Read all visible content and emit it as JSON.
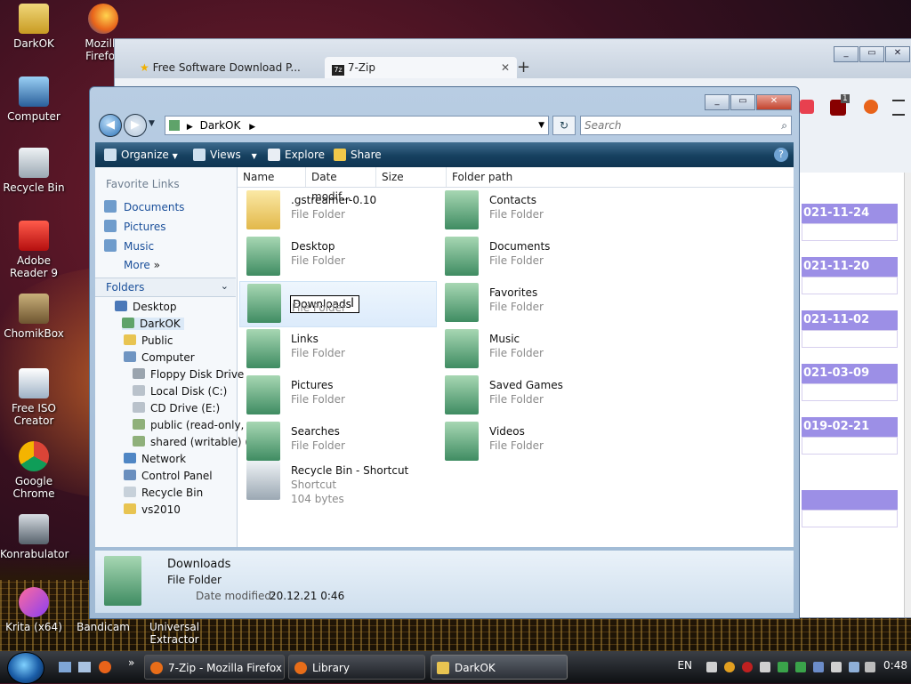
{
  "desktop": {
    "icons": [
      {
        "label": "DarkOK"
      },
      {
        "label": "Computer"
      },
      {
        "label": "Recycle Bin"
      },
      {
        "label": "Adobe Reader 9"
      },
      {
        "label": "ChomikBox"
      },
      {
        "label": "Free ISO Creator"
      },
      {
        "label": "Google Chrome"
      },
      {
        "label": "Konrabulator"
      },
      {
        "label": "Krita (x64)"
      },
      {
        "label": "Bandicam"
      },
      {
        "label": "Universal Extractor"
      },
      {
        "label": "Mozilla Firefox"
      }
    ]
  },
  "firefox": {
    "tabs": [
      {
        "label": "Free Software Download P..."
      },
      {
        "label": "7-Zip"
      }
    ],
    "new_tab": "+",
    "dates": [
      "021-11-24",
      "021-11-20",
      "021-11-02",
      "021-03-09",
      "019-02-21"
    ],
    "ublock_badge": "1"
  },
  "explorer": {
    "address": {
      "root": "DarkOK"
    },
    "search_placeholder": "Search",
    "toolbar": {
      "organize": "Organize",
      "views": "Views",
      "explore": "Explore",
      "share": "Share"
    },
    "favorite_links_header": "Favorite Links",
    "favorites": [
      {
        "label": "Documents"
      },
      {
        "label": "Pictures"
      },
      {
        "label": "Music"
      },
      {
        "label": "More"
      }
    ],
    "folders_header": "Folders",
    "tree": [
      {
        "label": "Desktop"
      },
      {
        "label": "DarkOK"
      },
      {
        "label": "Public"
      },
      {
        "label": "Computer"
      },
      {
        "label": "Floppy Disk Drive"
      },
      {
        "label": "Local Disk (C:)"
      },
      {
        "label": "CD Drive (E:)"
      },
      {
        "label": "public (read-only,"
      },
      {
        "label": "shared (writable) ("
      },
      {
        "label": "Network"
      },
      {
        "label": "Control Panel"
      },
      {
        "label": "Recycle Bin"
      },
      {
        "label": "vs2010"
      }
    ],
    "columns": [
      "Name",
      "Date modif...",
      "Size",
      "Folder path"
    ],
    "items_left": [
      {
        "name": ".gstreamer-0.10",
        "type": "File Folder"
      },
      {
        "name": "Desktop",
        "type": "File Folder"
      },
      {
        "name": "Downloads",
        "type": "File Folder"
      },
      {
        "name": "Links",
        "type": "File Folder"
      },
      {
        "name": "Pictures",
        "type": "File Folder"
      },
      {
        "name": "Searches",
        "type": "File Folder"
      },
      {
        "name": "Recycle Bin - Shortcut",
        "type": "Shortcut",
        "size": "104 bytes"
      }
    ],
    "items_right": [
      {
        "name": "Contacts",
        "type": "File Folder"
      },
      {
        "name": "Documents",
        "type": "File Folder"
      },
      {
        "name": "Favorites",
        "type": "File Folder"
      },
      {
        "name": "Music",
        "type": "File Folder"
      },
      {
        "name": "Saved Games",
        "type": "File Folder"
      },
      {
        "name": "Videos",
        "type": "File Folder"
      }
    ],
    "rename_value": "Downloads",
    "details": {
      "name": "Downloads",
      "type": "File Folder",
      "date_label": "Date modified:",
      "date_value": "20.12.21 0:46"
    }
  },
  "taskbar": {
    "tasks": [
      {
        "label": "7-Zip - Mozilla Firefox"
      },
      {
        "label": "Library"
      },
      {
        "label": "DarkOK"
      }
    ],
    "language": "EN",
    "clock": "0:48"
  }
}
